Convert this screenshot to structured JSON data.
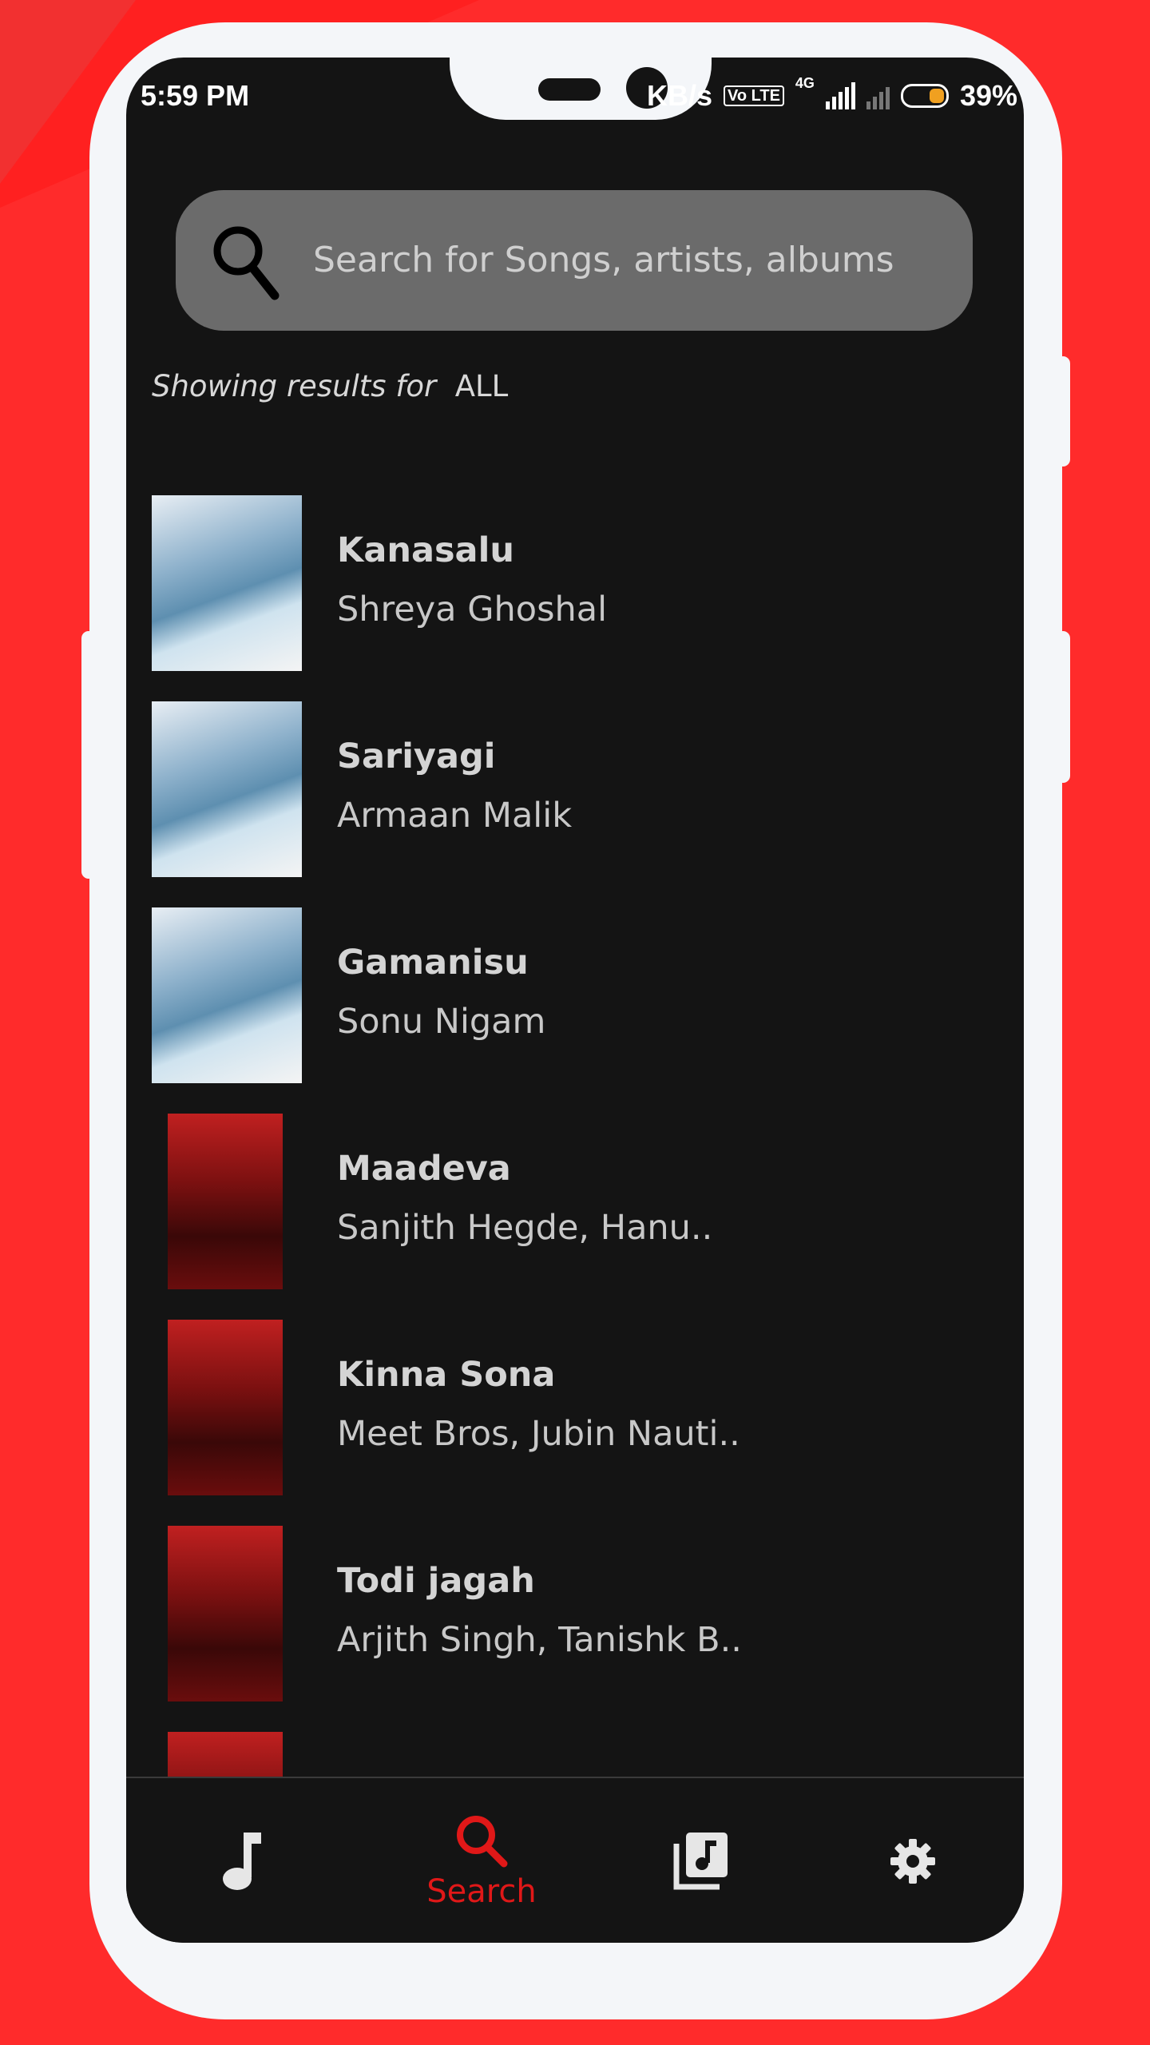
{
  "status_bar": {
    "time": "5:59 PM",
    "speed": "KB/s",
    "volte": "Vo LTE",
    "network": "4G",
    "battery": "39%"
  },
  "search": {
    "placeholder": "Search for Songs, artists, albums"
  },
  "results": {
    "prefix": "Showing results for",
    "filter": "ALL"
  },
  "songs": [
    {
      "title": "Kanasalu",
      "artist": "Shreya Ghoshal",
      "album_art": "mungaru-male-2-cover"
    },
    {
      "title": "Sariyagi",
      "artist": "Armaan Malik",
      "album_art": "mungaru-male-2-cover"
    },
    {
      "title": "Gamanisu",
      "artist": "Sonu Nigam",
      "album_art": "mungaru-male-2-cover"
    },
    {
      "title": "Maadeva",
      "artist": "Sanjith Hegde, Hanu..",
      "album_art": "marjaavaan-cover"
    },
    {
      "title": "Kinna Sona",
      "artist": "Meet Bros, Jubin Nauti..",
      "album_art": "marjaavaan-cover"
    },
    {
      "title": "Todi jagah",
      "artist": "Arjith Singh, Tanishk B..",
      "album_art": "marjaavaan-cover"
    }
  ],
  "nav": {
    "search_label": "Search",
    "active_color": "#e01818",
    "icons": [
      "music-note-icon",
      "search-icon",
      "library-icon",
      "settings-icon"
    ]
  }
}
